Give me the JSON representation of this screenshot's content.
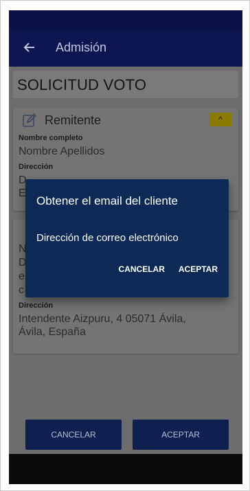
{
  "app_bar": {
    "title": "Admisión",
    "back_icon": "arrow-left-icon"
  },
  "page": {
    "title": "SOLICITUD VOTO"
  },
  "sender_card": {
    "title": "Remitente",
    "edit_icon": "edit-icon",
    "toggle_icon": "chevron-up-icon",
    "toggle_glyph": "^",
    "full_name_label": "Nombre completo",
    "full_name_value": "Nombre Apellidos",
    "address_label": "Dirección",
    "address_line_1": "D",
    "address_line_2": "E"
  },
  "recipient_card": {
    "row_1": "N",
    "row_2": "D",
    "row_3": "e",
    "row_4": "c",
    "address_label": "Dirección",
    "address_line_1": "Intendente Aizpuru, 4    05071 Ávila,",
    "address_line_2": "Ávila, España"
  },
  "dialog": {
    "title": "Obtener el email del cliente",
    "input_placeholder": "Dirección de correo electrónico",
    "cancel_label": "CANCELAR",
    "accept_label": "ACEPTAR"
  },
  "footer": {
    "cancel_label": "CANCELAR",
    "accept_label": "ACEPTAR"
  },
  "colors": {
    "app_bar": "#0d1550",
    "dialog": "#0d2a57",
    "accent_yellow": "#8a7a00",
    "button": "#0d2050"
  }
}
